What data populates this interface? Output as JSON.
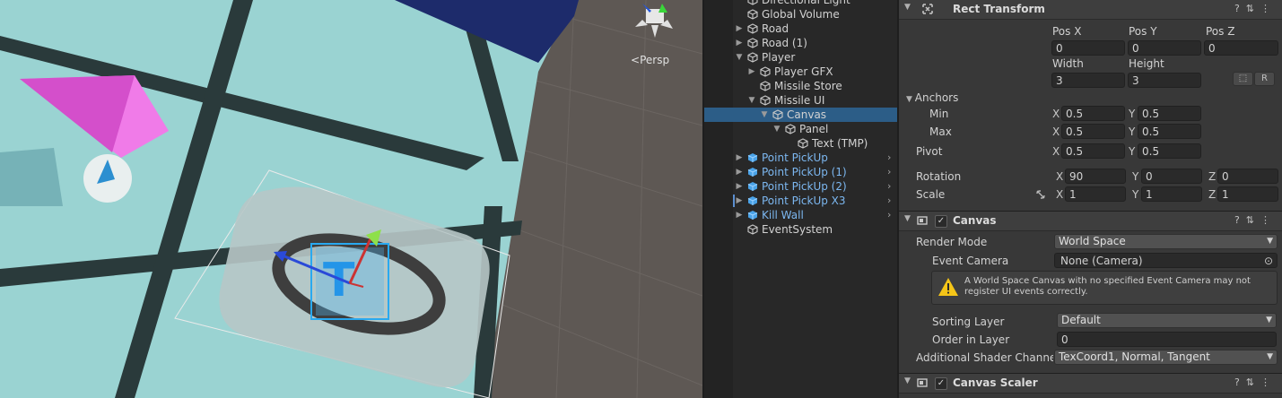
{
  "scene": {
    "view_mode": "Persp"
  },
  "hierarchy": {
    "items": [
      {
        "label": "Directional Light",
        "depth": 0,
        "expand": "none",
        "prefab": false,
        "selected": false,
        "chevron": false,
        "mark": false
      },
      {
        "label": "Global Volume",
        "depth": 0,
        "expand": "none",
        "prefab": false,
        "selected": false,
        "chevron": false,
        "mark": false
      },
      {
        "label": "Road",
        "depth": 0,
        "expand": "collapsed",
        "prefab": false,
        "selected": false,
        "chevron": false,
        "mark": false
      },
      {
        "label": "Road (1)",
        "depth": 0,
        "expand": "collapsed",
        "prefab": false,
        "selected": false,
        "chevron": false,
        "mark": false
      },
      {
        "label": "Player",
        "depth": 0,
        "expand": "expanded",
        "prefab": false,
        "selected": false,
        "chevron": false,
        "mark": false
      },
      {
        "label": "Player GFX",
        "depth": 1,
        "expand": "collapsed",
        "prefab": false,
        "selected": false,
        "chevron": false,
        "mark": false
      },
      {
        "label": "Missile Store",
        "depth": 1,
        "expand": "none",
        "prefab": false,
        "selected": false,
        "chevron": false,
        "mark": false
      },
      {
        "label": "Missile UI",
        "depth": 1,
        "expand": "expanded",
        "prefab": false,
        "selected": false,
        "chevron": false,
        "mark": false
      },
      {
        "label": "Canvas",
        "depth": 2,
        "expand": "expanded",
        "prefab": false,
        "selected": true,
        "chevron": false,
        "mark": false
      },
      {
        "label": "Panel",
        "depth": 3,
        "expand": "expanded",
        "prefab": false,
        "selected": false,
        "chevron": false,
        "mark": false
      },
      {
        "label": "Text (TMP)",
        "depth": 4,
        "expand": "none",
        "prefab": false,
        "selected": false,
        "chevron": false,
        "mark": false
      },
      {
        "label": "Point PickUp",
        "depth": 0,
        "expand": "collapsed",
        "prefab": true,
        "selected": false,
        "chevron": true,
        "mark": false
      },
      {
        "label": "Point PickUp (1)",
        "depth": 0,
        "expand": "collapsed",
        "prefab": true,
        "selected": false,
        "chevron": true,
        "mark": false
      },
      {
        "label": "Point PickUp (2)",
        "depth": 0,
        "expand": "collapsed",
        "prefab": true,
        "selected": false,
        "chevron": true,
        "mark": false
      },
      {
        "label": "Point PickUp X3",
        "depth": 0,
        "expand": "collapsed",
        "prefab": true,
        "selected": false,
        "chevron": true,
        "mark": true
      },
      {
        "label": "Kill Wall",
        "depth": 0,
        "expand": "collapsed",
        "prefab": true,
        "selected": false,
        "chevron": true,
        "mark": false
      },
      {
        "label": "EventSystem",
        "depth": 0,
        "expand": "none",
        "prefab": false,
        "selected": false,
        "chevron": false,
        "mark": false
      }
    ]
  },
  "rect_transform": {
    "title": "Rect Transform",
    "pos_x_label": "Pos X",
    "pos_y_label": "Pos Y",
    "pos_z_label": "Pos Z",
    "pos_x": "0",
    "pos_y": "0",
    "pos_z": "0",
    "width_label": "Width",
    "height_label": "Height",
    "width": "3",
    "height": "3",
    "r_button": "R",
    "anchors_label": "Anchors",
    "min_label": "Min",
    "max_label": "Max",
    "anchor_min_x": "0.5",
    "anchor_min_y": "0.5",
    "anchor_max_x": "0.5",
    "anchor_max_y": "0.5",
    "pivot_label": "Pivot",
    "pivot_x": "0.5",
    "pivot_y": "0.5",
    "rotation_label": "Rotation",
    "rot_x": "90",
    "rot_y": "0",
    "rot_z": "0",
    "scale_label": "Scale",
    "scale_x": "1",
    "scale_y": "1",
    "scale_z": "1",
    "x": "X",
    "y": "Y",
    "z": "Z"
  },
  "canvas": {
    "title": "Canvas",
    "render_mode_label": "Render Mode",
    "render_mode": "World Space",
    "event_camera_label": "Event Camera",
    "event_camera": "None (Camera)",
    "warning": "A World Space Canvas with no specified Event Camera may not register UI events correctly.",
    "sorting_layer_label": "Sorting Layer",
    "sorting_layer": "Default",
    "order_label": "Order in Layer",
    "order": "0",
    "shader_label": "Additional Shader Channels",
    "shader_channels": "TexCoord1, Normal, Tangent"
  },
  "canvas_scaler": {
    "title": "Canvas Scaler"
  },
  "colors": {
    "selection": "#2c5d87",
    "prefab_text": "#7cb7f0",
    "ground": "#9ad3d2",
    "road_line": "#2a3a3b",
    "pink": "#e35ad6",
    "gizmo_blue": "#29a9f0"
  }
}
